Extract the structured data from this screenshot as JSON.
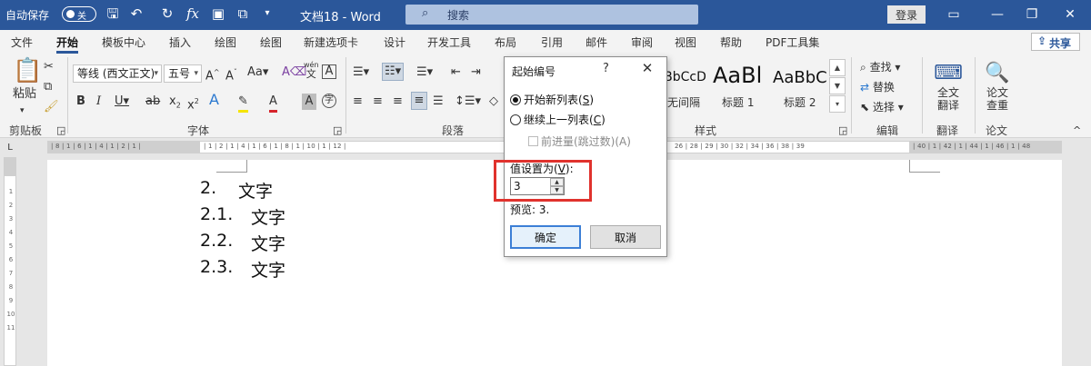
{
  "titlebar": {
    "autosave_label": "自动保存",
    "toggle_label": "关",
    "doc_title": "文档18 - Word",
    "search_placeholder": "搜索",
    "login_label": "登录",
    "colors": {
      "bar": "#2b579a"
    }
  },
  "menu": {
    "tabs": [
      "文件",
      "开始",
      "模板中心",
      "插入",
      "绘图",
      "绘图",
      "新建选项卡",
      "设计",
      "开发工具",
      "布局",
      "引用",
      "邮件",
      "审阅",
      "视图",
      "帮助",
      "PDF工具集"
    ],
    "active": "开始",
    "share_label": "共享"
  },
  "ribbon": {
    "clipboard": {
      "paste_label": "粘贴",
      "group": "剪贴板"
    },
    "font": {
      "font_name": "等线 (西文正文)",
      "font_size": "五号",
      "group": "字体",
      "wen_top": "wén",
      "wen_bottom": "文"
    },
    "paragraph": {
      "group": "段落"
    },
    "styles": {
      "group": "样式",
      "items": [
        {
          "preview": "AaBbCcDc",
          "name": "无间隔"
        },
        {
          "preview": "AaBl",
          "name": "标题 1"
        },
        {
          "preview": "AaBbC",
          "name": "标题 2"
        }
      ]
    },
    "editing": {
      "find": "查找",
      "replace": "替换",
      "select": "选择",
      "group": "编辑"
    },
    "translate": {
      "label_1": "全文",
      "label_2": "翻译",
      "group": "翻译"
    },
    "paper": {
      "label_1": "论文",
      "label_2": "查重",
      "group": "论文"
    }
  },
  "ruler": {
    "numbers": "| 8 | 6 | 4 | 2 |   | 2 | 4 | 6 | 8 | 10 | 12 | 14 | 16 | 18 | 20 | 22 | 24 | 26 | 28 | 29 | 30 | 32 | 34 | 36 | 38 | 39 | 40 | 42 | 44 | 46 | 48",
    "left_part": "| 8 | 1 | 6 | 1 | 4 | 1 | 2 | 1 |",
    "mid_part": "| 1 | 2 | 1 | 4 | 1 | 6 | 1 | 8 | 1 | 10 | 1 | 12 |",
    "right_part": "26 | 28 | 29 | 30 | 32 | 34 | 36 | 38 | 39",
    "far_right": "| 40 | 1 | 42 | 1 | 44 | 1 | 46 | 1 | 48",
    "vertical": [
      "1",
      "2",
      "3",
      "4",
      "5",
      "6",
      "7",
      "8",
      "9",
      "10",
      "11"
    ]
  },
  "document": {
    "lines": [
      {
        "num": "2.",
        "text": "文字"
      },
      {
        "num": "2.1.",
        "text": "文字"
      },
      {
        "num": "2.2.",
        "text": "文字"
      },
      {
        "num": "2.3.",
        "text": "文字"
      }
    ]
  },
  "dialog": {
    "title": "起始编号",
    "help": "?",
    "close": "✕",
    "option_new": "开始新列表(",
    "option_new_key": "S",
    "option_continue": "继续上一列表(",
    "option_continue_key": "C",
    "advance_label": "前进量(跳过数)(A)",
    "value_label_pre": "值设置为(",
    "value_label_key": "V",
    "value_label_post": "):",
    "value": "3",
    "preview": "预览: 3.",
    "ok": "确定",
    "cancel": "取消",
    "highlight_color": "#e0322d"
  }
}
